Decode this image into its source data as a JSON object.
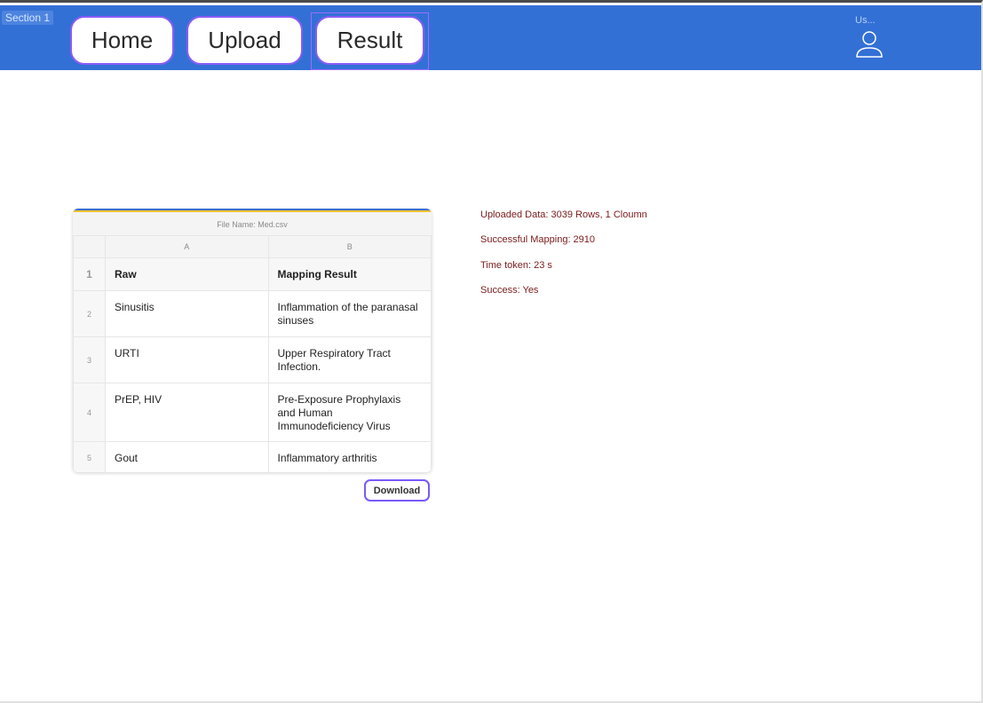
{
  "section_tag": "Section 1",
  "nav": {
    "home": "Home",
    "upload": "Upload",
    "result": "Result"
  },
  "user": {
    "label": "Us...",
    "icon": "user-icon"
  },
  "table": {
    "file_name": "File Name: Med.csv",
    "column_letters": [
      "A",
      "B"
    ],
    "headers": [
      "Raw",
      "Mapping Result"
    ],
    "rows": [
      {
        "num": "1",
        "raw": "Raw",
        "mapping": "Mapping Result"
      },
      {
        "num": "2",
        "raw": "Sinusitis",
        "mapping": "Inflammation of the paranasal sinuses"
      },
      {
        "num": "3",
        "raw": "URTI",
        "mapping": "Upper Respiratory Tract Infection."
      },
      {
        "num": "4",
        "raw": "PrEP, HIV",
        "mapping": "Pre-Exposure Prophylaxis and Human Immunodeficiency Virus"
      },
      {
        "num": "5",
        "raw": "Gout",
        "mapping": "Inflammatory arthritis"
      }
    ]
  },
  "download_label": "Download",
  "stats": {
    "uploaded": "Uploaded Data: 3039 Rows, 1 Cloumn",
    "mapping": "Successful Mapping: 2910",
    "time": "Time token: 23 s",
    "success": "Success: Yes"
  },
  "colors": {
    "header_bg": "#3370d6",
    "button_border": "#8b5cf6",
    "stats_text": "#7a1a1a"
  }
}
